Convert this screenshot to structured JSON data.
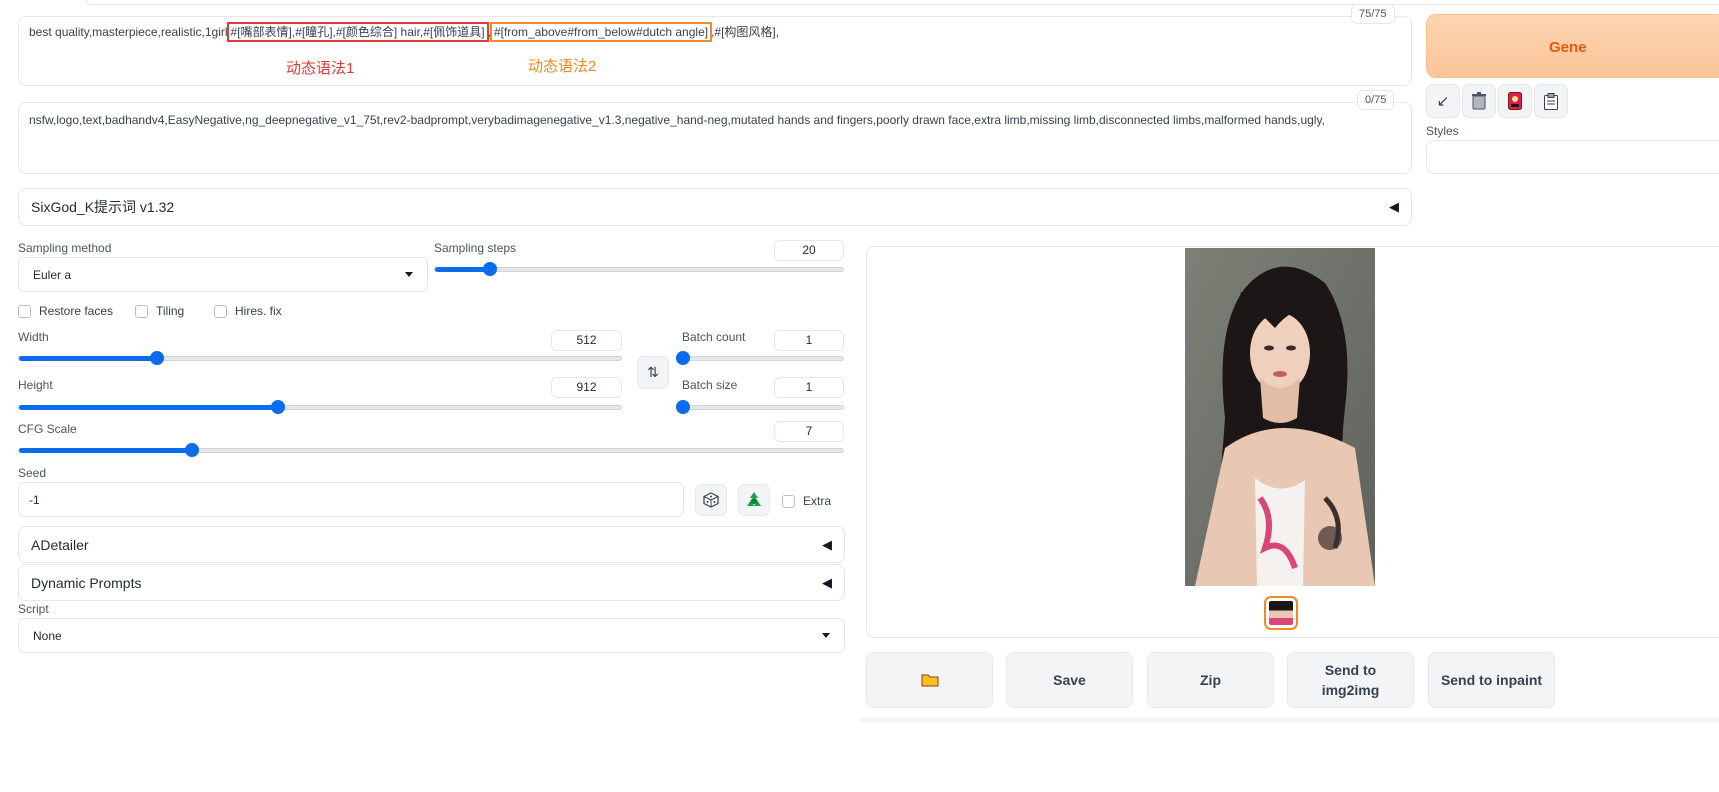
{
  "prompt": {
    "part1": "best quality,masterpiece,realistic,1girl",
    "dyn1": "#[嘴部表情],#[瞳孔],#[颜色综合] hair,#[佩饰道具]",
    "part2": ",",
    "dyn2": "#[from_above#from_below#dutch angle]",
    "part3": ",#[构图风格],",
    "counter": "75/75"
  },
  "annotations": {
    "syntax1": "动态语法1",
    "syntax2": "动态语法2"
  },
  "negative_prompt": {
    "text": "nsfw,logo,text,badhandv4,EasyNegative,ng_deepnegative_v1_75t,rev2-badprompt,verybadimagenegative_v1.3,negative_hand-neg,mutated hands and fingers,poorly drawn face,extra limb,missing limb,disconnected limbs,malformed hands,ugly,",
    "counter": "0/75"
  },
  "generate": {
    "label": "Gene"
  },
  "styles": {
    "label": "Styles"
  },
  "sixgod": {
    "label": "SixGod_K提示词 v1.32"
  },
  "sampling": {
    "method_label": "Sampling method",
    "method_value": "Euler a",
    "steps_label": "Sampling steps",
    "steps_value": "20",
    "steps_fraction": 0.135
  },
  "options": {
    "restore_faces": "Restore faces",
    "tiling": "Tiling",
    "hires_fix": "Hires. fix"
  },
  "width": {
    "label": "Width",
    "value": "512",
    "fraction": 0.23
  },
  "height": {
    "label": "Height",
    "value": "912",
    "fraction": 0.43
  },
  "batch_count": {
    "label": "Batch count",
    "value": "1",
    "fraction": 0.0
  },
  "batch_size": {
    "label": "Batch size",
    "value": "1",
    "fraction": 0.0
  },
  "cfg": {
    "label": "CFG Scale",
    "value": "7",
    "fraction": 0.21
  },
  "seed": {
    "label": "Seed",
    "value": "-1",
    "extra_label": "Extra"
  },
  "adetailer": {
    "label": "ADetailer"
  },
  "dynamic_prompts": {
    "label": "Dynamic Prompts"
  },
  "script": {
    "label": "Script",
    "value": "None"
  },
  "output_buttons": {
    "save": "Save",
    "zip": "Zip",
    "send_img2img": "Send to img2img",
    "send_inpaint": "Send to inpaint"
  },
  "colors": {
    "accent": "#0b6cf0",
    "generate": "#ea580c",
    "highlight_red": "#e53935",
    "highlight_orange": "#f08a24"
  },
  "icons": [
    "arrow-icon",
    "trash-icon",
    "card-icon",
    "clipboard-icon",
    "swap-icon",
    "dice-icon",
    "recycle-icon",
    "folder-icon"
  ]
}
